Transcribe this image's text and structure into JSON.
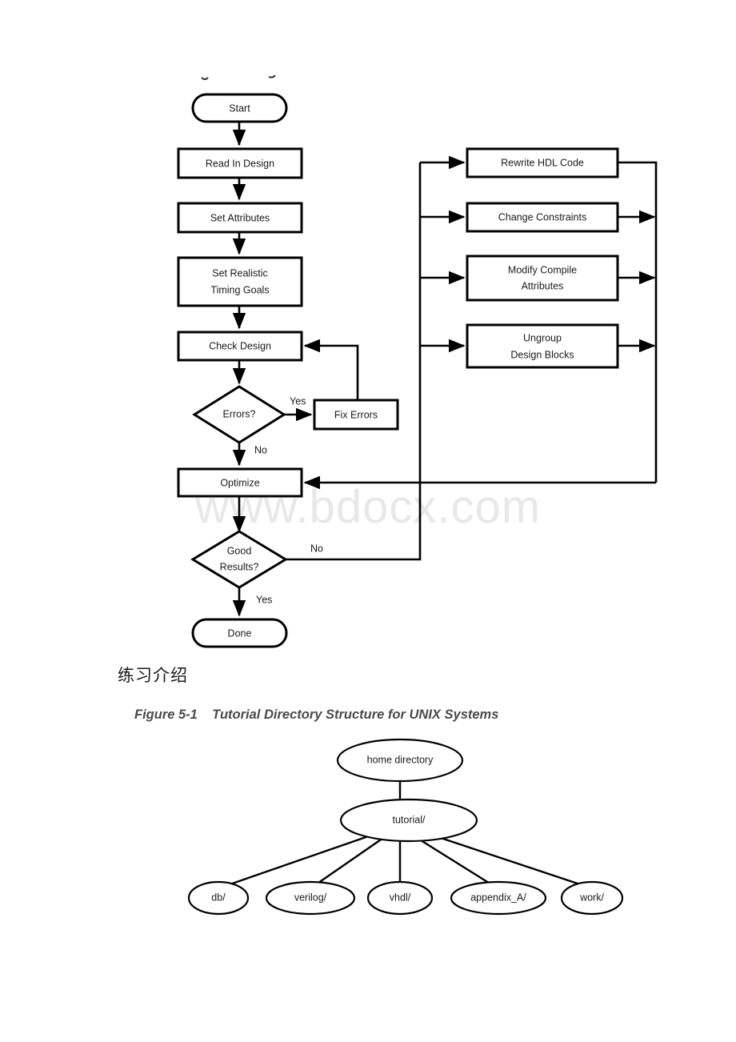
{
  "page": {
    "watermark": "www.bdocx.com",
    "chinese_heading": "练习介绍",
    "figure_caption": "Figure 5-1    Tutorial Directory Structure for UNIX Systems"
  },
  "flowchart": {
    "nodes": {
      "start": "Start",
      "read_in_design": "Read In Design",
      "set_attributes": "Set Attributes",
      "set_realistic_timing_goals_l1": "Set Realistic",
      "set_realistic_timing_goals_l2": "Timing Goals",
      "check_design": "Check Design",
      "errors": "Errors?",
      "fix_errors": "Fix Errors",
      "optimize": "Optimize",
      "good_results_l1": "Good",
      "good_results_l2": "Results?",
      "done": "Done",
      "rewrite_hdl_code": "Rewrite HDL Code",
      "change_constraints": "Change Constraints",
      "modify_compile_l1": "Modify Compile",
      "modify_compile_l2": "Attributes",
      "ungroup_l1": "Ungroup",
      "ungroup_l2": "Design Blocks"
    },
    "edge_labels": {
      "errors_yes": "Yes",
      "errors_no": "No",
      "good_results_no": "No",
      "good_results_yes": "Yes"
    }
  },
  "tree": {
    "root": "home directory",
    "level2": "tutorial/",
    "leaves": [
      "db/",
      "verilog/",
      "vhdl/",
      "appendix_A/",
      "work/"
    ]
  }
}
